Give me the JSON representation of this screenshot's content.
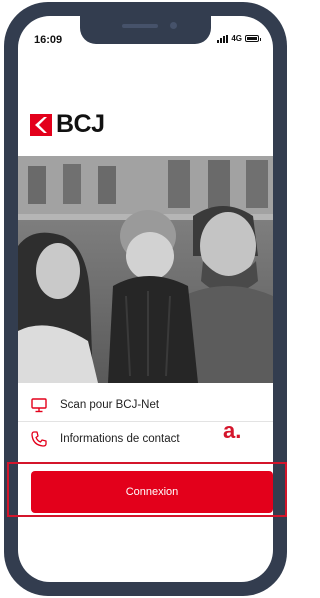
{
  "status_bar": {
    "time": "16:09",
    "network": "4G"
  },
  "brand": {
    "name": "BCJ",
    "accent_color": "#e3001b"
  },
  "hero_photo": {
    "icon": "family-photo"
  },
  "menu": {
    "items": [
      {
        "icon": "monitor-icon",
        "label": "Scan pour BCJ-Net"
      },
      {
        "icon": "phone-icon",
        "label": "Informations de contact"
      }
    ]
  },
  "annotation": {
    "label": "a.",
    "color": "#d4152b"
  },
  "login_button": {
    "label": "Connexion"
  }
}
